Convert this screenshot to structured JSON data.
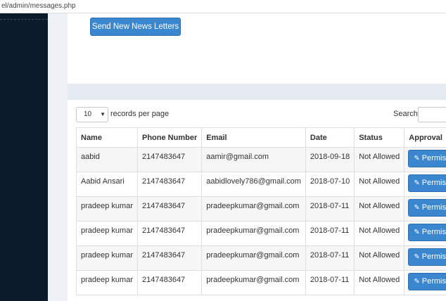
{
  "browser": {
    "url": "el/admin/messages.php"
  },
  "top": {
    "send_button": "Send New News Letters"
  },
  "table_controls": {
    "length_value": "10",
    "length_label": "records per page",
    "search_label": "Search:"
  },
  "columns": [
    "Name",
    "Phone Number",
    "Email",
    "Date",
    "Status",
    "Approval"
  ],
  "rows": [
    {
      "name": "aabid",
      "phone": "2147483647",
      "email": "aamir@gmail.com",
      "date": "2018-09-18",
      "status": "Not Allowed",
      "action": "Permission"
    },
    {
      "name": "Aabid Ansari",
      "phone": "2147483647",
      "email": "aabidlovely786@gmail.com",
      "date": "2018-07-10",
      "status": "Not Allowed",
      "action": "Permission"
    },
    {
      "name": "pradeep kumar",
      "phone": "2147483647",
      "email": "pradeepkumar@gmail.com",
      "date": "2018-07-11",
      "status": "Not Allowed",
      "action": "Permission"
    },
    {
      "name": "pradeep kumar",
      "phone": "2147483647",
      "email": "pradeepkumar@gmail.com",
      "date": "2018-07-11",
      "status": "Not Allowed",
      "action": "Permission"
    },
    {
      "name": "pradeep kumar",
      "phone": "2147483647",
      "email": "pradeepkumar@gmail.com",
      "date": "2018-07-11",
      "status": "Not Allowed",
      "action": "Permission"
    },
    {
      "name": "pradeep kumar",
      "phone": "2147483647",
      "email": "pradeepkumar@gmail.com",
      "date": "2018-07-11",
      "status": "Not Allowed",
      "action": "Permission"
    }
  ],
  "icons": {
    "permission": "edit-icon"
  },
  "colors": {
    "primary": "#3a87cf",
    "sidebar": "#0c1b2a"
  }
}
